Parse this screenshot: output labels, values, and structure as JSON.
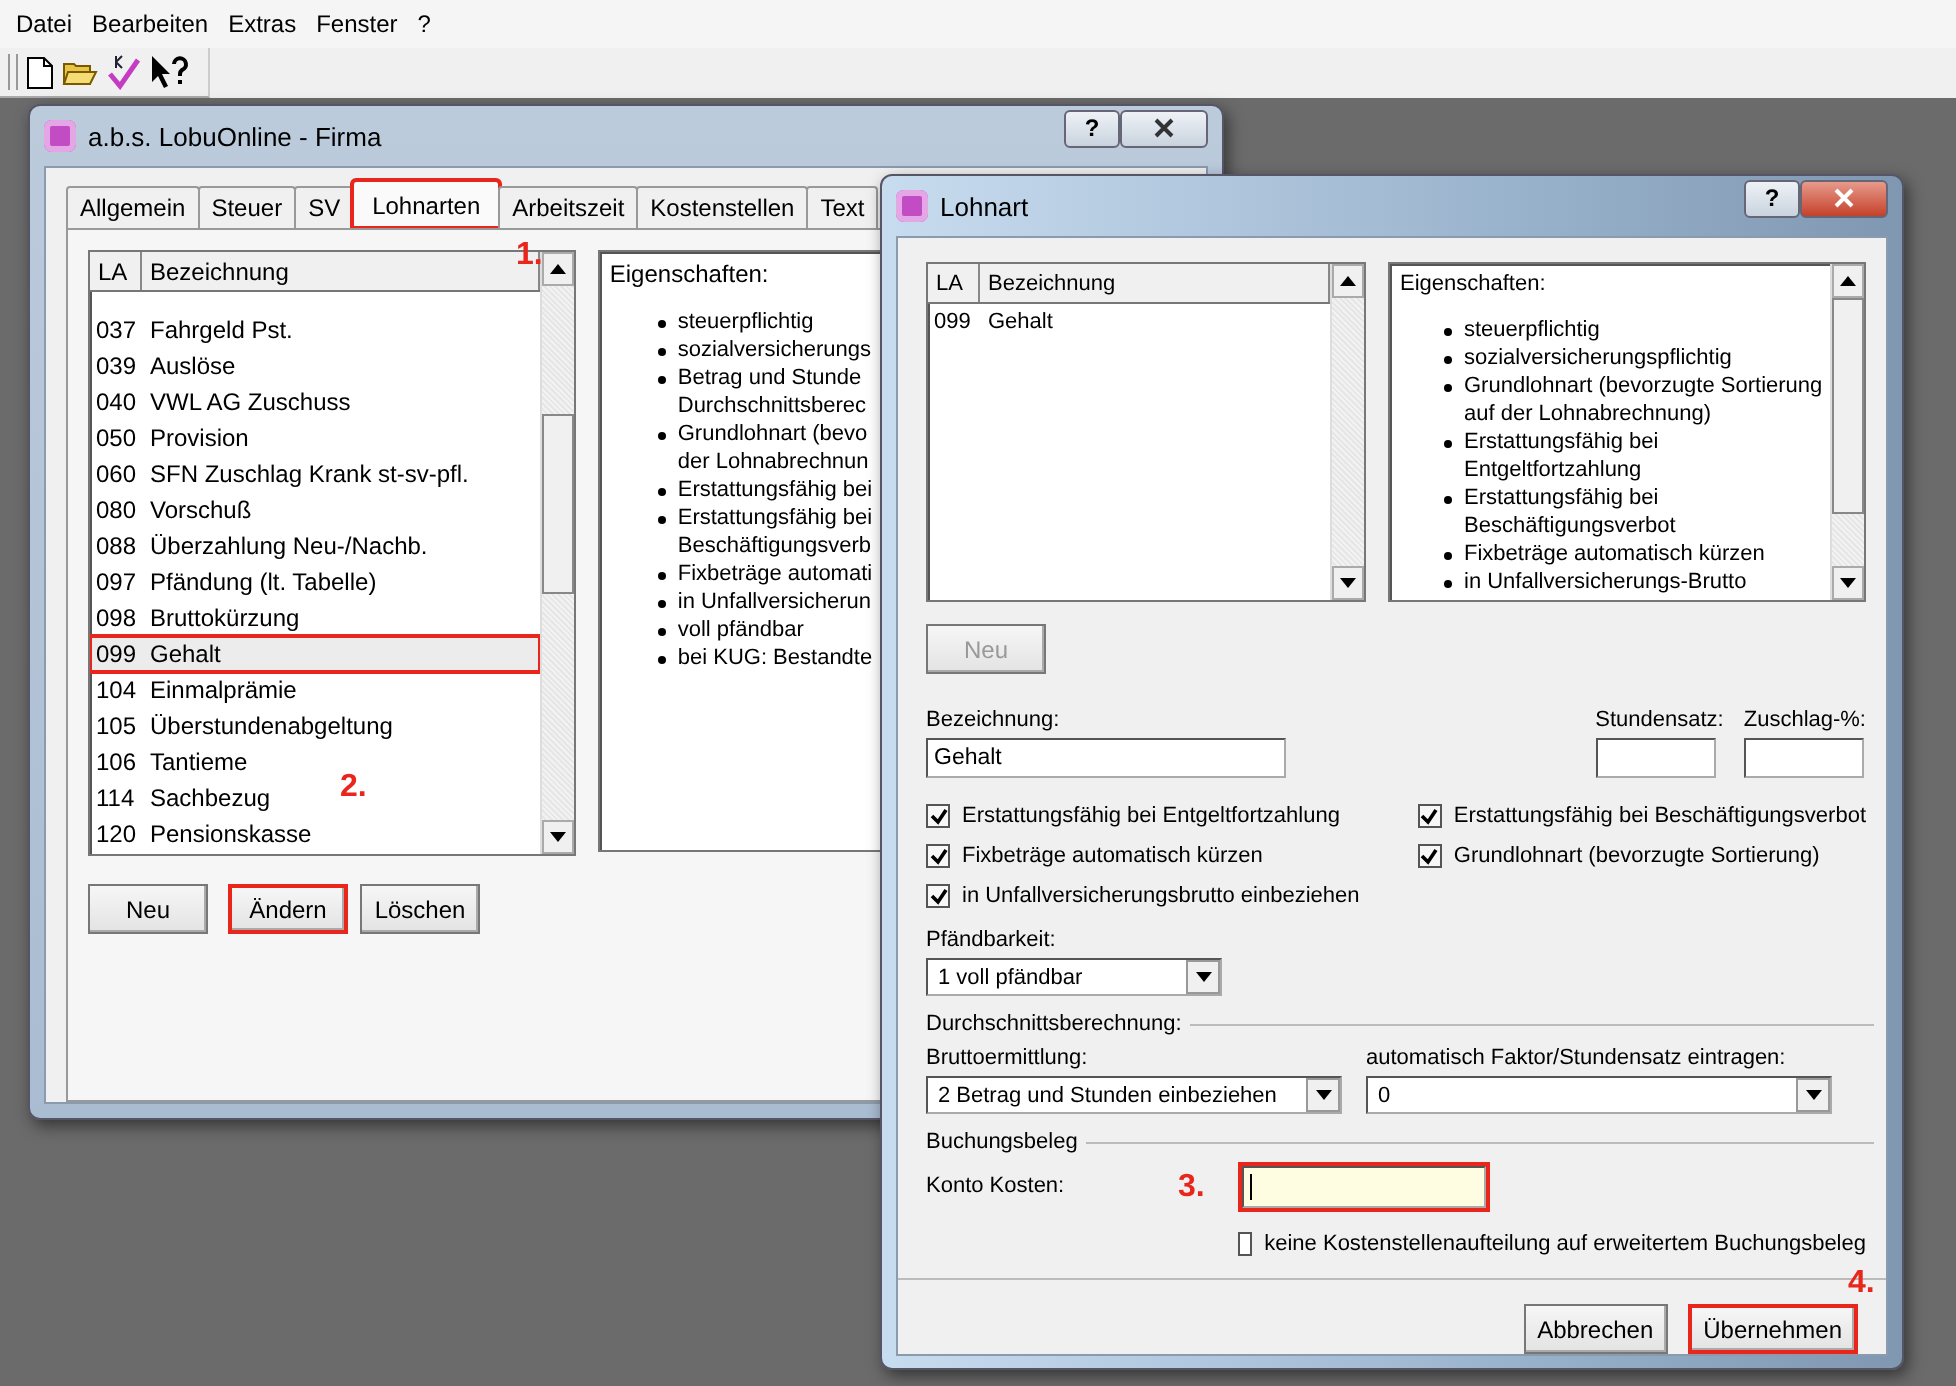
{
  "menu_bar": [
    "Datei",
    "Bearbeiten",
    "Extras",
    "Fenster",
    "?"
  ],
  "main_window": {
    "title": "a.b.s. LobuOnline - Firma",
    "help_button": "?",
    "tabs": [
      {
        "label": "Allgemein",
        "selected": false,
        "highlighted": false
      },
      {
        "label": "Steuer",
        "selected": false,
        "highlighted": false
      },
      {
        "label": "SV",
        "selected": false,
        "highlighted": false
      },
      {
        "label": "Lohnarten",
        "selected": true,
        "highlighted": true
      },
      {
        "label": "Arbeitszeit",
        "selected": false,
        "highlighted": false
      },
      {
        "label": "Kostenstellen",
        "selected": false,
        "highlighted": false
      },
      {
        "label": "Text",
        "selected": false,
        "highlighted": false
      }
    ],
    "list": {
      "columns": [
        "LA",
        "Bezeichnung"
      ],
      "rows": [
        {
          "la": "037",
          "name": "Fahrgeld Pst.",
          "selected": false,
          "highlighted": false
        },
        {
          "la": "039",
          "name": "Auslöse",
          "selected": false,
          "highlighted": false
        },
        {
          "la": "040",
          "name": "VWL AG Zuschuss",
          "selected": false,
          "highlighted": false
        },
        {
          "la": "050",
          "name": "Provision",
          "selected": false,
          "highlighted": false
        },
        {
          "la": "060",
          "name": "SFN Zuschlag Krank st-sv-pfl.",
          "selected": false,
          "highlighted": false
        },
        {
          "la": "080",
          "name": "Vorschuß",
          "selected": false,
          "highlighted": false
        },
        {
          "la": "088",
          "name": "Überzahlung Neu-/Nachb.",
          "selected": false,
          "highlighted": false
        },
        {
          "la": "097",
          "name": "Pfändung (lt. Tabelle)",
          "selected": false,
          "highlighted": false
        },
        {
          "la": "098",
          "name": "Bruttokürzung",
          "selected": false,
          "highlighted": false
        },
        {
          "la": "099",
          "name": "Gehalt",
          "selected": true,
          "highlighted": true
        },
        {
          "la": "104",
          "name": "Einmalprämie",
          "selected": false,
          "highlighted": false
        },
        {
          "la": "105",
          "name": "Überstundenabgeltung",
          "selected": false,
          "highlighted": false
        },
        {
          "la": "106",
          "name": "Tantieme",
          "selected": false,
          "highlighted": false
        },
        {
          "la": "114",
          "name": "Sachbezug",
          "selected": false,
          "highlighted": false
        },
        {
          "la": "120",
          "name": "Pensionskasse",
          "selected": false,
          "highlighted": false
        }
      ]
    },
    "properties": {
      "heading": "Eigenschaften:",
      "items": [
        {
          "lines": [
            "steuerpflichtig"
          ]
        },
        {
          "lines": [
            "sozialversicherungs"
          ]
        },
        {
          "lines": [
            "Betrag und Stunde",
            "Durchschnittsberec"
          ]
        },
        {
          "lines": [
            "Grundlohnart (bevo",
            "der Lohnabrechnun"
          ]
        },
        {
          "lines": [
            "Erstattungsfähig bei"
          ]
        },
        {
          "lines": [
            "Erstattungsfähig bei",
            "Beschäftigungsverb"
          ]
        },
        {
          "lines": [
            "Fixbeträge automati"
          ]
        },
        {
          "lines": [
            "in Unfallversicherun"
          ]
        },
        {
          "lines": [
            "voll pfändbar"
          ]
        },
        {
          "lines": [
            "bei KUG: Bestandte"
          ]
        }
      ]
    },
    "buttons": [
      {
        "label": "Neu",
        "highlighted": false
      },
      {
        "label": "Ändern",
        "highlighted": true
      },
      {
        "label": "Löschen",
        "highlighted": false
      }
    ]
  },
  "dialog": {
    "title": "Lohnart",
    "help_button": "?",
    "list": {
      "columns": [
        "LA",
        "Bezeichnung"
      ],
      "rows": [
        {
          "la": "099",
          "name": "Gehalt"
        }
      ]
    },
    "properties": {
      "heading": "Eigenschaften:",
      "items": [
        {
          "lines": [
            "steuerpflichtig"
          ]
        },
        {
          "lines": [
            "sozialversicherungspflichtig"
          ]
        },
        {
          "lines": [
            "Grundlohnart (bevorzugte Sortierung",
            "auf der Lohnabrechnung)"
          ]
        },
        {
          "lines": [
            "Erstattungsfähig bei",
            "Entgeltfortzahlung"
          ]
        },
        {
          "lines": [
            "Erstattungsfähig bei",
            "Beschäftigungsverbot"
          ]
        },
        {
          "lines": [
            "Fixbeträge automatisch kürzen"
          ]
        },
        {
          "lines": [
            "in Unfallversicherungs-Brutto"
          ]
        }
      ]
    },
    "new_button": {
      "label": "Neu",
      "disabled": true
    },
    "bezeichnung": {
      "label": "Bezeichnung:",
      "value": "Gehalt"
    },
    "stundensatz": {
      "label": "Stundensatz:"
    },
    "zuschlag": {
      "label": "Zuschlag-%:"
    },
    "checks_left": [
      {
        "label": "Erstattungsfähig bei Entgeltfortzahlung",
        "checked": true
      },
      {
        "label": "Fixbeträge automatisch kürzen",
        "checked": true
      },
      {
        "label": "in Unfallversicherungsbrutto einbeziehen",
        "checked": true
      }
    ],
    "checks_right": [
      {
        "label": "Erstattungsfähig bei Beschäftigungsverbot",
        "checked": true
      },
      {
        "label": "Grundlohnart (bevorzugte Sortierung)",
        "checked": true
      }
    ],
    "pfaendbarkeit": {
      "label": "Pfändbarkeit:",
      "value": "1 voll pfändbar"
    },
    "durchschnitt": {
      "heading": "Durchschnittsberechnung:",
      "bruttoermittlung": {
        "label": "Bruttoermittlung:",
        "value": "2 Betrag und Stunden einbeziehen"
      },
      "faktor": {
        "label": "automatisch Faktor/Stundensatz eintragen:",
        "value": "0"
      }
    },
    "buchungsbeleg": {
      "heading": "Buchungsbeleg",
      "konto_kosten": {
        "label": "Konto Kosten:",
        "highlighted": true
      },
      "no_split": {
        "label": "keine Kostenstellenaufteilung auf erweitertem Buchungsbeleg",
        "checked": false
      }
    },
    "buttons": [
      {
        "label": "Abbrechen",
        "highlighted": false
      },
      {
        "label": "Übernehmen",
        "highlighted": true
      }
    ]
  },
  "annotations": [
    "1.",
    "2.",
    "3.",
    "4."
  ]
}
